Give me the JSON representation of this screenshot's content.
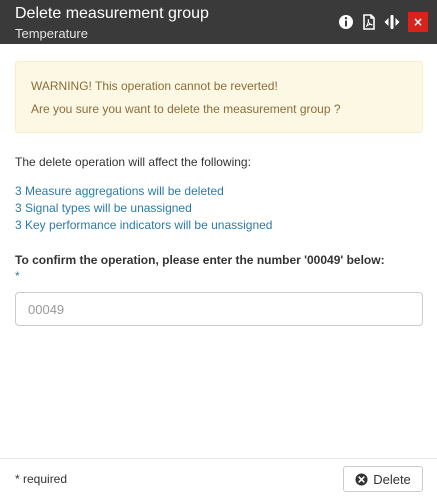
{
  "dialog": {
    "title": "Delete measurement group",
    "subtitle": "Temperature",
    "close_label": "×",
    "icons": [
      "info-icon",
      "pdf-icon",
      "resize-icon"
    ]
  },
  "warning": {
    "line1": "WARNING! This operation cannot be reverted!",
    "line2": "Are you sure you want to delete the measurement group ?"
  },
  "affect_text": "The delete operation will affect the following:",
  "effects": [
    "3 Measure aggregations will be deleted",
    "3 Signal types will be unassigned",
    "3 Key performance indicators will be unassigned"
  ],
  "confirm": {
    "label": "To confirm the operation, please enter the number '00049' below:",
    "required_marker": "*",
    "placeholder": "00049",
    "value": ""
  },
  "footer": {
    "required_note": "* required",
    "delete_label": "Delete"
  },
  "colors": {
    "header_bg": "#3a3a3a",
    "close_red": "#d9221c",
    "warning_bg": "#fcf8e3",
    "warning_text": "#8a6d3b",
    "link_blue": "#2a7bad"
  }
}
